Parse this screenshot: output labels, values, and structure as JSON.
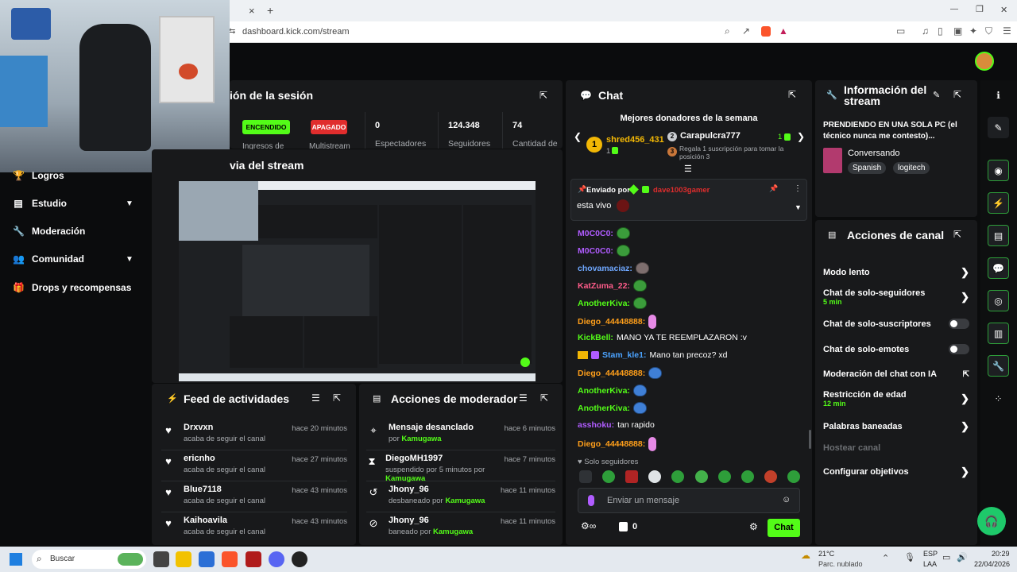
{
  "browser": {
    "close_tab": "×",
    "new_tab": "+",
    "url": "dashboard.kick.com/stream",
    "win_min": "—",
    "win_max": "❐",
    "win_close": "✕"
  },
  "session": {
    "title": "ión de la sesión",
    "on_label": "ENCENDIDO",
    "off_label": "APAGADO",
    "ingress_label": "Ingresos de",
    "multistream_label": "Multistream",
    "viewers_value": "0",
    "viewers_label": "Espectadores",
    "followers_value": "124.348",
    "followers_label": "Seguidores",
    "count_value": "74",
    "count_label": "Cantidad de"
  },
  "preview": {
    "title": "via del stream"
  },
  "sidebar": {
    "items": [
      {
        "label": "Logros",
        "icon": "trophy-icon"
      },
      {
        "label": "Estudio",
        "icon": "studio-icon"
      },
      {
        "label": "Moderación",
        "icon": "wrench-icon"
      },
      {
        "label": "Comunidad",
        "icon": "people-icon"
      },
      {
        "label": "Drops y recompensas",
        "icon": "gift-icon"
      }
    ]
  },
  "feed": {
    "title": "Feed de actividades",
    "rows": [
      {
        "name": "Drxvxn",
        "sub": "acaba de seguir el canal",
        "time": "hace 20 minutos"
      },
      {
        "name": "ericnho",
        "sub": "acaba de seguir el canal",
        "time": "hace 27 minutos"
      },
      {
        "name": "Blue7118",
        "sub": "acaba de seguir el canal",
        "time": "hace 43 minutos"
      },
      {
        "name": "Kaihoavila",
        "sub": "acaba de seguir el canal",
        "time": "hace 43 minutos"
      }
    ]
  },
  "mod_actions": {
    "title": "Acciones de moderador",
    "rows": [
      {
        "name": "Mensaje desanclado",
        "pre": "por ",
        "who": "Kamugawa",
        "time": "hace 6 minutos",
        "icon": "unpin-icon"
      },
      {
        "name": "DiegoMH1997",
        "pre": "suspendido por 5 minutos por ",
        "who": "Kamugawa",
        "time": "hace 7 minutos",
        "icon": "hourglass-icon"
      },
      {
        "name": "Jhony_96",
        "pre": "desbaneado por ",
        "who": "Kamugawa",
        "time": "hace 11 minutos",
        "icon": "undo-icon"
      },
      {
        "name": "Jhony_96",
        "pre": "baneado por ",
        "who": "Kamugawa",
        "time": "hace 11 minutos",
        "icon": "ban-icon"
      }
    ]
  },
  "chat": {
    "title": "Chat",
    "donors_title": "Mejores donadores de la semana",
    "donor1_name": "shred456_431",
    "donor1_rank": "1",
    "donor1_count": "1",
    "donor2_name": "Carapulcra777",
    "donor2_rank": "2",
    "donor2_count": "1",
    "donor3_rank": "3",
    "donor3_text": "Regala 1 suscripción para tomar la posición 3",
    "pinned_by_label": "Enviado por",
    "pinned_user": "dave1003gamer",
    "pinned_message": "esta vivo",
    "messages": [
      {
        "user": "M0C0C0:",
        "color": "#b05cff",
        "text": "",
        "emote": "pepe"
      },
      {
        "user": "M0C0C0:",
        "color": "#b05cff",
        "text": "",
        "emote": "pepe"
      },
      {
        "user": "chovamaciaz:",
        "color": "#6fa8ff",
        "text": "",
        "emote": "rock"
      },
      {
        "user": "KatZuma_22:",
        "color": "#ff5c8a",
        "text": "",
        "emote": "pepe"
      },
      {
        "user": "AnotherKiva:",
        "color": "#53fc18",
        "text": "",
        "emote": "pepe"
      },
      {
        "user": "Diego_44448888:",
        "color": "#ff9f1a",
        "text": "",
        "emote": "worm"
      },
      {
        "user": "KickBell:",
        "color": "#53fc18",
        "text": "MANO YA TE REEMPLAZARON :v",
        "emote": ""
      },
      {
        "user": "Stam_kle1:",
        "color": "#4ba3ff",
        "text": "Mano tan precoz? xd",
        "emote": ""
      },
      {
        "user": "Diego_44448888:",
        "color": "#ff9f1a",
        "text": "",
        "emote": "pepe"
      },
      {
        "user": "AnotherKiva:",
        "color": "#53fc18",
        "text": "",
        "emote": "pepe"
      },
      {
        "user": "AnotherKiva:",
        "color": "#53fc18",
        "text": "",
        "emote": "pepe"
      },
      {
        "user": "asshoku:",
        "color": "#b05cff",
        "text": "tan rapido",
        "emote": ""
      },
      {
        "user": "Diego_44448888:",
        "color": "#ff9f1a",
        "text": "",
        "emote": "worm"
      }
    ],
    "followers_only": "Solo seguidores",
    "input_placeholder": "Enviar un mensaje",
    "points_value": "0",
    "send_label": "Chat"
  },
  "stream_info": {
    "title": "Información del stream",
    "stream_title": "PRENDIENDO EN UNA SOLA PC (el técnico nunca me contesto)...",
    "category": "Conversando",
    "tags": [
      "Spanish",
      "logitech"
    ]
  },
  "channel_actions": {
    "title": "Acciones de canal",
    "slow_mode": "Modo lento",
    "followers_only": "Chat de solo-seguidores",
    "followers_only_time": "5 min",
    "subs_only": "Chat de solo-suscriptores",
    "emotes_only": "Chat de solo-emotes",
    "ai_moderation": "Moderación del chat con IA",
    "age_restriction": "Restricción de edad",
    "age_restriction_time": "12 min",
    "banned_words": "Palabras baneadas",
    "host_channel": "Hostear canal",
    "goals": "Configurar objetivos"
  },
  "taskbar": {
    "search": "Buscar",
    "weather_temp": "21°C",
    "weather_desc": "Parc. nublado",
    "lang1": "ESP",
    "lang2": "LAA",
    "time": "20:29",
    "date": "22/04/2026"
  },
  "colors": {
    "accent": "#53fc18",
    "panel": "#18191b",
    "background": "#0b0c0d",
    "danger": "#e02d2d"
  }
}
